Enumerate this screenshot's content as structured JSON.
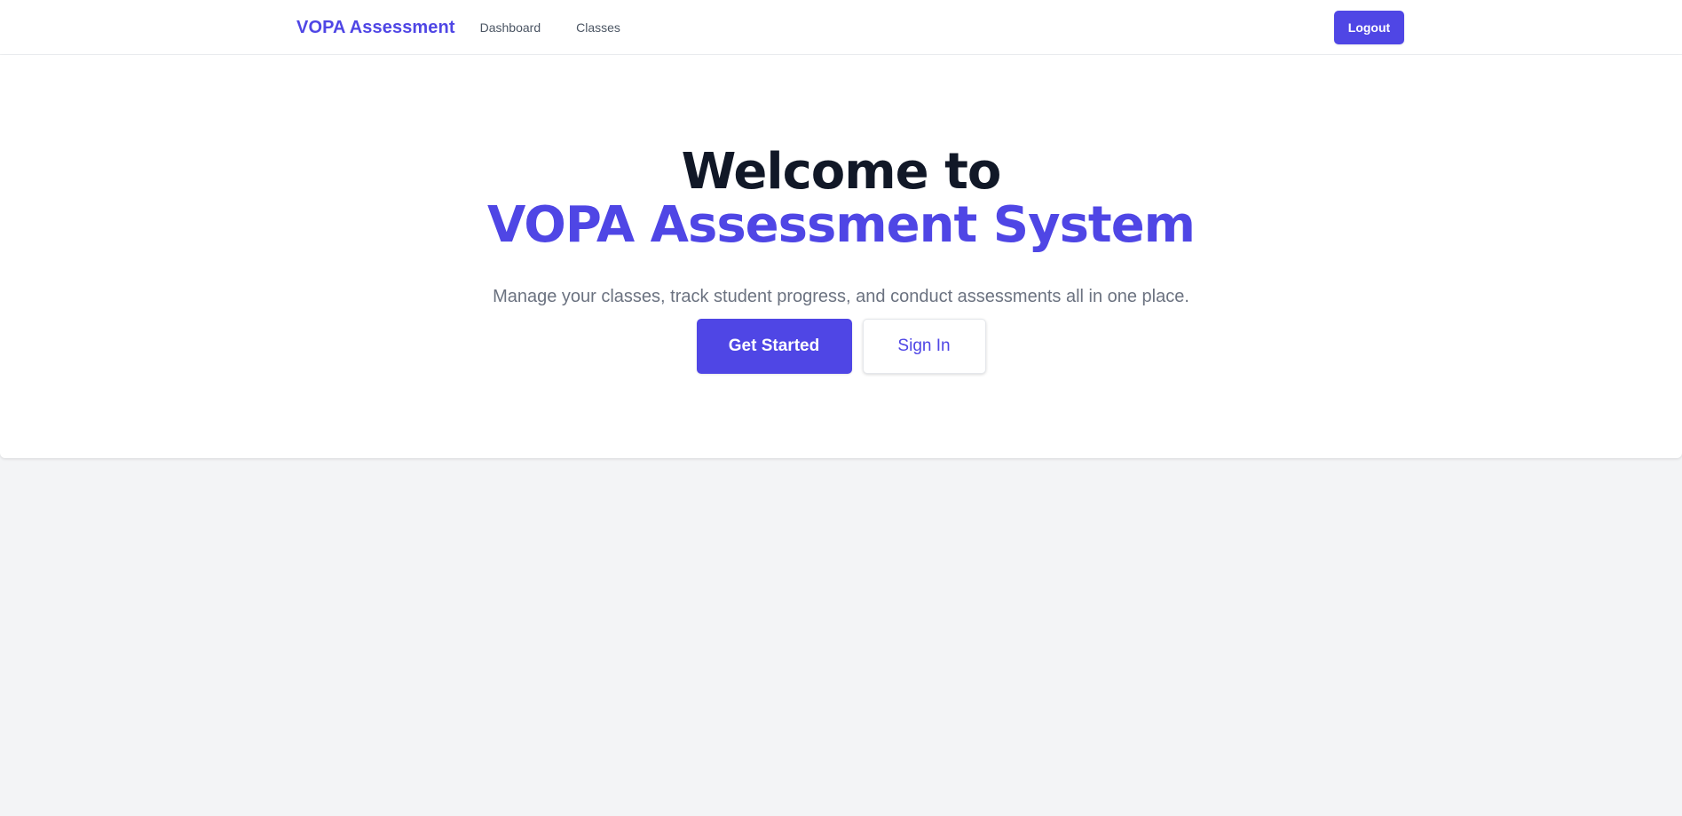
{
  "navbar": {
    "brand": "VOPA Assessment",
    "links": [
      {
        "label": "Dashboard"
      },
      {
        "label": "Classes"
      }
    ],
    "logout_label": "Logout"
  },
  "hero": {
    "title_line1": "Welcome to",
    "title_line2": "VOPA Assessment System",
    "subtitle": "Manage your classes, track student progress, and conduct assessments all in one place.",
    "primary_button": "Get Started",
    "secondary_button": "Sign In"
  },
  "colors": {
    "accent": "#4f46e5",
    "heading": "#111827",
    "muted_text": "#6b7280",
    "page_background": "#f3f4f6",
    "surface": "#ffffff"
  }
}
